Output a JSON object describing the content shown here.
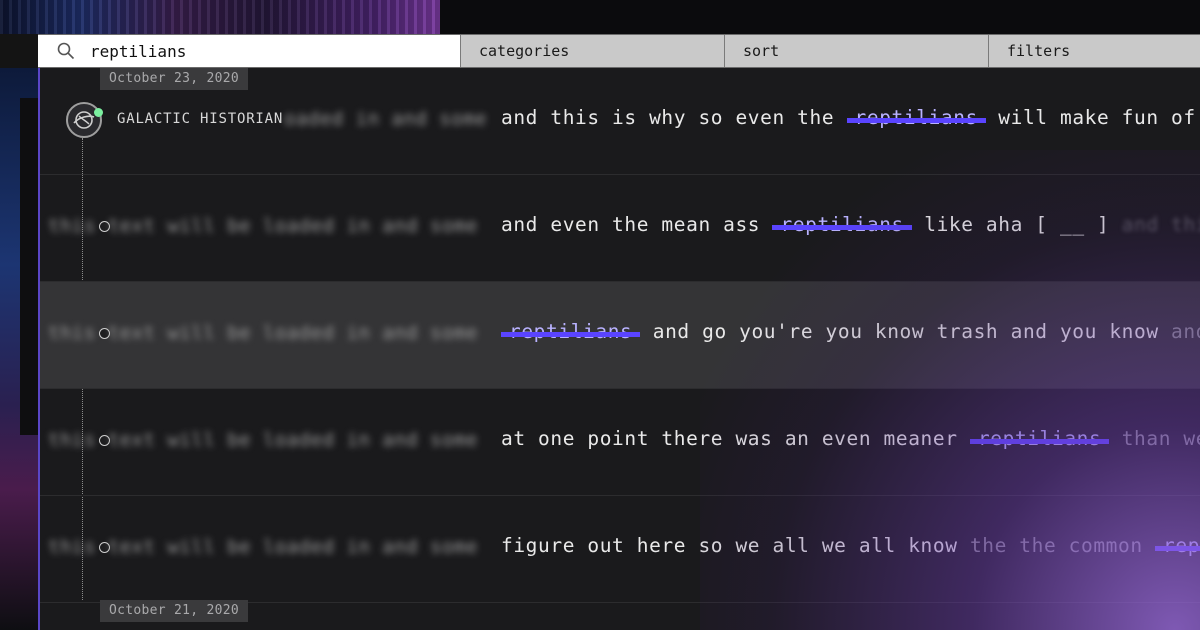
{
  "search": {
    "query": "reptilians"
  },
  "toolbar": {
    "categories_label": "categories",
    "sort_label": "sort",
    "filters_label": "filters"
  },
  "dates": [
    "October 23, 2020",
    "October 21, 2020"
  ],
  "speaker": {
    "name": "GALACTIC HISTORIAN"
  },
  "highlight_color": "#5a44ff",
  "rows": [
    {
      "blur": "oaded in and some",
      "before": "and this is why so even the",
      "match": "reptilians",
      "after": "will make fun of",
      "tail": ""
    },
    {
      "blur": "this text will be loaded in and some",
      "before": "and even the mean ass",
      "match": "reptilians",
      "after": "like aha [ __ ]",
      "tail": "and thi"
    },
    {
      "blur": "this text will be loaded in and some",
      "before": "",
      "match": "reptilians",
      "after": "and go you're you know trash and you know",
      "tail": "and"
    },
    {
      "blur": "this text will be loaded in and some",
      "before": "at one point there was an even meaner",
      "match": "reptilians",
      "after": "",
      "tail": "than we"
    },
    {
      "blur": "this text will be loaded in and some",
      "before": "figure out here so we all we all know",
      "match": "rep",
      "after": "",
      "tail": "the the common"
    }
  ]
}
